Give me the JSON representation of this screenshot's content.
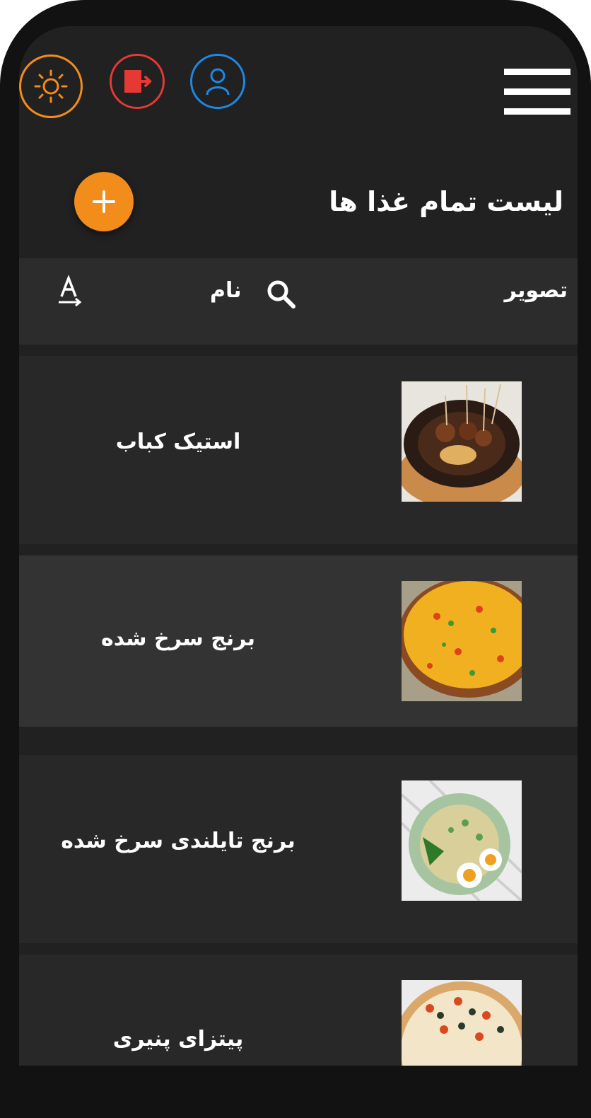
{
  "header": {
    "menu_icon": "hamburger-menu-icon",
    "theme_icon": "sun-icon",
    "logout_icon": "logout-door-icon",
    "profile_icon": "user-icon",
    "colors": {
      "theme": "#f28c1b",
      "logout": "#e53935",
      "profile": "#1e88e5"
    }
  },
  "page": {
    "title": "لیست تمام غذا ها",
    "add_icon": "plus-icon",
    "accent": "#f28c1b"
  },
  "table": {
    "columns": {
      "image": "تصویر",
      "name": "نام"
    },
    "search_icon": "search-icon",
    "sort_icon": "sort-alpha-icon",
    "rows": [
      {
        "name": "استیک کباب",
        "image": "steak-kebab-photo"
      },
      {
        "name": "برنج سرخ شده",
        "image": "fried-rice-photo"
      },
      {
        "name": "برنج تایلندی سرخ شده",
        "image": "thai-fried-rice-photo"
      },
      {
        "name": "پیتزای پنیری",
        "image": "cheese-pizza-photo"
      }
    ]
  }
}
